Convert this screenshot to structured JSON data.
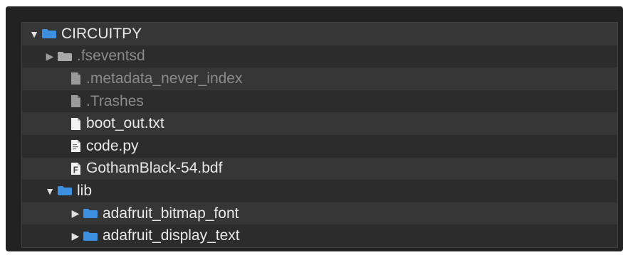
{
  "tree": {
    "items": [
      {
        "name": "CIRCUITPY",
        "kind": "folder",
        "state": "expanded",
        "depth": 0,
        "dim": false
      },
      {
        "name": ".fseventsd",
        "kind": "folder",
        "state": "collapsed",
        "depth": 1,
        "dim": true
      },
      {
        "name": ".metadata_never_index",
        "kind": "file",
        "icon": "blank-file-icon",
        "depth": 1,
        "dim": true
      },
      {
        "name": ".Trashes",
        "kind": "file",
        "icon": "blank-file-icon",
        "depth": 1,
        "dim": true
      },
      {
        "name": "boot_out.txt",
        "kind": "file",
        "icon": "blank-file-icon",
        "depth": 1,
        "dim": false
      },
      {
        "name": "code.py",
        "kind": "file",
        "icon": "code-file-icon",
        "depth": 1,
        "dim": false
      },
      {
        "name": "GothamBlack-54.bdf",
        "kind": "file",
        "icon": "font-file-icon",
        "depth": 1,
        "dim": false
      },
      {
        "name": "lib",
        "kind": "folder",
        "state": "expanded",
        "depth": 1,
        "dim": false
      },
      {
        "name": "adafruit_bitmap_font",
        "kind": "folder",
        "state": "collapsed",
        "depth": 2,
        "dim": false
      },
      {
        "name": "adafruit_display_text",
        "kind": "folder",
        "state": "collapsed",
        "depth": 2,
        "dim": false
      }
    ]
  },
  "colors": {
    "folder": "#3d8fe0",
    "background": "#222222",
    "row_light": "#363636",
    "row_dark": "#2c2c2c",
    "text": "#e8e8e8",
    "text_dim": "#8a8a8a"
  }
}
